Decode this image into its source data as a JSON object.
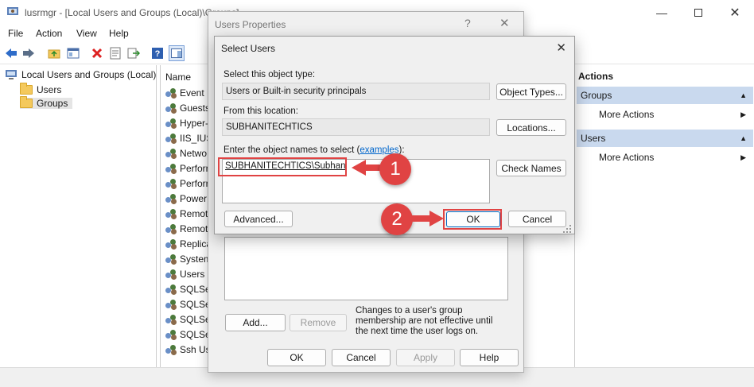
{
  "window": {
    "title": "lusrmgr - [Local Users and Groups (Local)\\Groups]",
    "minimize_icon": "minimize-icon",
    "maximize_icon": "maximize-icon",
    "close_icon": "close-icon"
  },
  "menu": [
    "File",
    "Action",
    "View",
    "Help"
  ],
  "tree": {
    "root": "Local Users and Groups (Local)",
    "items": [
      "Users",
      "Groups"
    ]
  },
  "list": {
    "header": "Name",
    "items": [
      "Event L",
      "Guests",
      "Hyper-",
      "IIS_IUSI",
      "Netwo",
      "Perforr",
      "Perforr",
      "Power",
      "Remote",
      "Remote",
      "Replica",
      "System",
      "Users",
      "SQLSer",
      "SQLSer",
      "SQLSer",
      "SQLSer",
      "Ssh Use"
    ]
  },
  "actions": {
    "header": "Actions",
    "sections": [
      {
        "title": "Groups",
        "item": "More Actions"
      },
      {
        "title": "Users",
        "item": "More Actions"
      }
    ]
  },
  "props_dialog": {
    "title": "Users Properties",
    "help": "?",
    "close": "✕",
    "add": "Add...",
    "remove": "Remove",
    "note": "Changes to a user's group membership are not effective until the next time the user logs on.",
    "ok": "OK",
    "cancel": "Cancel",
    "apply": "Apply",
    "help_btn": "Help"
  },
  "select_dialog": {
    "title": "Select Users",
    "close": "✕",
    "object_type_label": "Select this object type:",
    "object_type_value": "Users or Built-in security principals",
    "object_types_btn": "Object Types...",
    "location_label": "From this location:",
    "location_value": "SUBHANITECHTICS",
    "locations_btn": "Locations...",
    "enter_label_pre": "Enter the object names to select (",
    "enter_label_link": "examples",
    "enter_label_post": "):",
    "names_value": "SUBHANITECHTICS\\Subhan",
    "check_names_btn": "Check Names",
    "advanced_btn": "Advanced...",
    "ok_btn": "OK",
    "cancel_btn": "Cancel"
  },
  "annotations": {
    "step1": "1",
    "step2": "2",
    "color": "#e04343"
  }
}
